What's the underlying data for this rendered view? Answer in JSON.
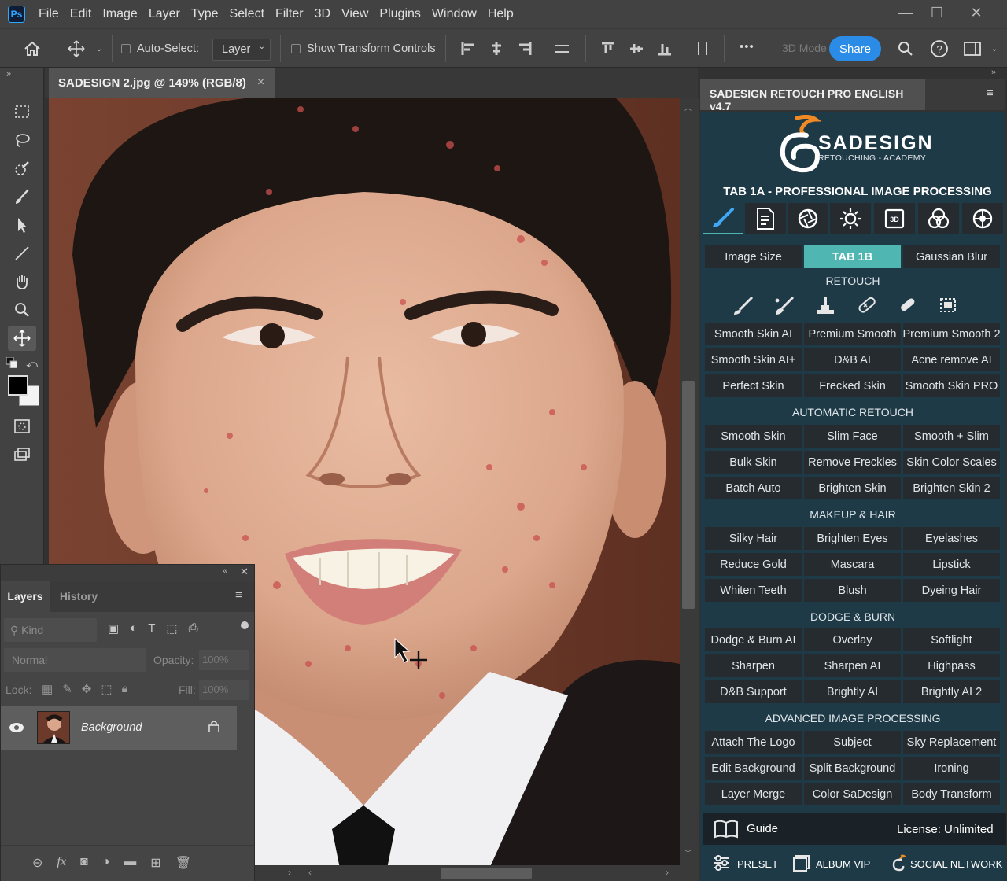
{
  "app": {
    "logo_text": "Ps"
  },
  "menu": [
    "File",
    "Edit",
    "Image",
    "Layer",
    "Type",
    "Select",
    "Filter",
    "3D",
    "View",
    "Plugins",
    "Window",
    "Help"
  ],
  "window_controls": {
    "minimize": "—",
    "restore": "☐",
    "close": "✕"
  },
  "options": {
    "auto_select_label": "Auto-Select:",
    "auto_select_target": "Layer",
    "show_transform_label": "Show Transform Controls",
    "more": "•••",
    "mode_3d": "3D Mode",
    "share": "Share"
  },
  "document": {
    "tab_title": "SADESIGN 2.jpg @ 149% (RGB/8)",
    "close": "×"
  },
  "tool_icons": [
    "marquee-icon",
    "lasso-icon",
    "quick-select-icon",
    "brush-icon",
    "path-select-icon",
    "line-icon",
    "hand-icon",
    "zoom-icon",
    "move-icon"
  ],
  "layers_panel": {
    "tabs": [
      "Layers",
      "History"
    ],
    "search_placeholder": "Kind",
    "blend_mode": "Normal",
    "opacity_label": "Opacity:",
    "opacity_value": "100%",
    "lock_label": "Lock:",
    "fill_label": "Fill:",
    "fill_value": "100%",
    "layer_name": "Background",
    "footer": {
      "link": "⊝",
      "fx": "fx"
    }
  },
  "plugin": {
    "panel_title": "SADESIGN RETOUCH PRO ENGLISH v4.7",
    "brand_name": "SADESIGN",
    "brand_sub": "RETOUCHING - ACADEMY",
    "tab_heading": "TAB 1A - PROFESSIONAL IMAGE PROCESSING",
    "top_buttons": [
      "Image Size",
      "TAB 1B",
      "Gaussian Blur"
    ],
    "sections": [
      {
        "title": "RETOUCH",
        "buttons": [
          "Smooth Skin AI",
          "Premium Smooth",
          "Premium Smooth 2",
          "Smooth Skin AI+",
          "D&B AI",
          "Acne remove AI",
          "Perfect Skin",
          "Frecked Skin",
          "Smooth Skin PRO"
        ]
      },
      {
        "title": "AUTOMATIC RETOUCH",
        "buttons": [
          "Smooth Skin",
          "Slim Face",
          "Smooth + Slim",
          "Bulk Skin",
          "Remove Freckles",
          "Skin Color Scales",
          "Batch Auto",
          "Brighten Skin",
          "Brighten Skin 2"
        ]
      },
      {
        "title": "MAKEUP & HAIR",
        "buttons": [
          "Silky Hair",
          "Brighten Eyes",
          "Eyelashes",
          "Reduce Gold",
          "Mascara",
          "Lipstick",
          "Whiten Teeth",
          "Blush",
          "Dyeing Hair"
        ]
      },
      {
        "title": "DODGE & BURN",
        "buttons": [
          "Dodge & Burn AI",
          "Overlay",
          "Softlight",
          "Sharpen",
          "Sharpen AI",
          "Highpass",
          "D&B Support",
          "Brightly AI",
          "Brightly AI 2"
        ]
      },
      {
        "title": "ADVANCED IMAGE PROCESSING",
        "buttons": [
          "Attach The Logo",
          "Subject",
          "Sky Replacement",
          "Edit Background",
          "Split Background",
          "Ironing",
          "Layer Merge",
          "Color SaDesign",
          "Body Transform"
        ]
      }
    ],
    "guide": "Guide",
    "license": "License: Unlimited",
    "footer": [
      "PRESET",
      "ALBUM VIP",
      "SOCIAL NETWORK"
    ]
  },
  "colors": {
    "accent": "#2a8ce6",
    "active_tab": "#4fb6b2",
    "panel_bg": "#1f3a47",
    "button_bg": "#262b2f",
    "brand_orange": "#f08a24"
  }
}
